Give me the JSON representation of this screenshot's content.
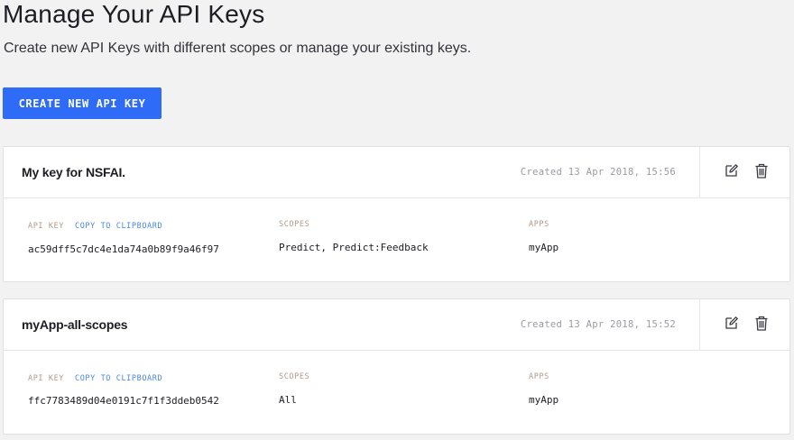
{
  "header": {
    "title": "Manage Your API Keys",
    "subtitle": "Create new API Keys with different scopes or manage your existing keys."
  },
  "actions": {
    "create_label": "CREATE NEW API KEY"
  },
  "columns": {
    "api_key_label": "API KEY",
    "copy_label": "COPY TO CLIPBOARD",
    "scopes_label": "SCOPES",
    "apps_label": "APPS"
  },
  "keys": [
    {
      "name": "My key for NSFAI.",
      "created": "Created 13 Apr 2018, 15:56",
      "api_key": "ac59dff5c7dc4e1da74a0b89f9a46f97",
      "scopes": "Predict, Predict:Feedback",
      "apps": "myApp"
    },
    {
      "name": "myApp-all-scopes",
      "created": "Created 13 Apr 2018, 15:52",
      "api_key": "ffc7783489d04e0191c7f1f3ddeb0542",
      "scopes": "All",
      "apps": "myApp"
    }
  ],
  "icons": {
    "edit": "edit-icon",
    "delete": "trash-icon"
  },
  "colors": {
    "accent": "#2e6bf6",
    "link": "#4a86e8",
    "label": "#b09a8a",
    "background": "#f2f2f3"
  }
}
